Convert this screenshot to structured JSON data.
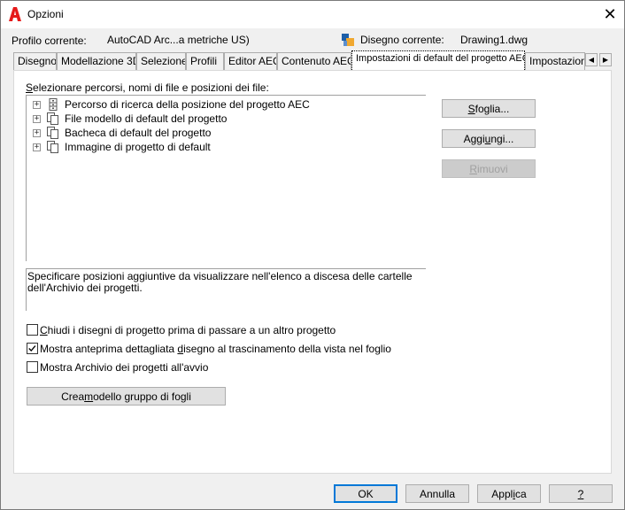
{
  "window": {
    "title": "Opzioni",
    "close_glyph": "✕",
    "app_icon": "autocad-logo-icon"
  },
  "header": {
    "profile_label": "Profilo corrente:",
    "profile_value": "AutoCAD Arc...a metriche US)",
    "drawing_label": "Disegno corrente:",
    "drawing_value": "Drawing1.dwg"
  },
  "tabs": [
    {
      "label": "Disegno"
    },
    {
      "label": "Modellazione 3D"
    },
    {
      "label": "Selezione"
    },
    {
      "label": "Profili"
    },
    {
      "label": "Editor AEC"
    },
    {
      "label": "Contenuto AEC"
    },
    {
      "label": "Impostazioni di default del progetto AEC",
      "active": true
    },
    {
      "label": "Impostazioni d"
    }
  ],
  "tab_scroll": {
    "left": "◀",
    "right": "▶"
  },
  "panel": {
    "select_label_pre": "S",
    "select_label_rest": "elezionare percorsi, nomi di file e posizioni dei file:",
    "tree_items": [
      {
        "label": "Percorso di ricerca della posizione del progetto AEC",
        "icon": "file-cabinet-icon"
      },
      {
        "label": "File modello di default del progetto",
        "icon": "documents-icon"
      },
      {
        "label": "Bacheca di default del progetto",
        "icon": "documents-icon"
      },
      {
        "label": "Immagine di progetto di default",
        "icon": "documents-icon"
      }
    ],
    "expander_glyph": "+",
    "description": "Specificare posizioni aggiuntive da visualizzare nell'elenco a discesa delle cartelle dell'Archivio dei progetti.",
    "buttons": {
      "browse": {
        "u": "S",
        "rest": "foglia..."
      },
      "add": {
        "pre": "Aggi",
        "u": "u",
        "rest": "ngi..."
      },
      "remove": {
        "u": "R",
        "rest": "imuovi"
      }
    },
    "checkboxes": [
      {
        "u": "C",
        "rest": "hiudi i disegni di progetto prima di passare a un altro progetto",
        "checked": false
      },
      {
        "pre": "Mostra anteprima dettagliata ",
        "u": "d",
        "rest": "isegno al trascinamento della vista nel foglio",
        "checked": true
      },
      {
        "pre": "Mostra Archivio dei progetti all'avvio",
        "u": "",
        "rest": "",
        "checked": false
      }
    ],
    "template_button": {
      "pre": "Crea ",
      "u": "m",
      "rest": "odello gruppo di fogli"
    }
  },
  "footer": {
    "ok": "OK",
    "cancel": "Annulla",
    "apply": {
      "pre": "Appl",
      "u": "i",
      "rest": "ca"
    },
    "help": "?"
  },
  "colors": {
    "accent": "#0078d7",
    "autocad_red": "#e51a1a"
  }
}
